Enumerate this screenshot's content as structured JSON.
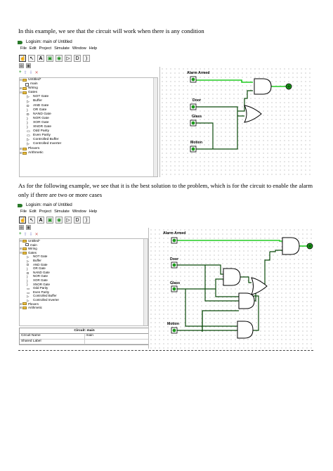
{
  "paragraph1": "In this example, we see that the circuit will work when there is any condition",
  "paragraph2": "As for the following example, we see that it is the best solution to the problem, which is for the circuit to enable the alarm only if there are two or more cases",
  "app": {
    "title": "Logisim: main of Untitled",
    "menu": [
      "File",
      "Edit",
      "Project",
      "Simulate",
      "Window",
      "Help"
    ],
    "tree": {
      "project": "Untitled*",
      "main": "main",
      "wiring": "Wiring",
      "gates": "Gates",
      "gate_items": [
        "NOT Gate",
        "Buffer",
        "AND Gate",
        "OR Gate",
        "NAND Gate",
        "NOR Gate",
        "XOR Gate",
        "XNOR Gate",
        "Odd Parity",
        "Even Parity",
        "Controlled Buffer",
        "Controlled Inverter"
      ],
      "plexers": "Plexers",
      "arithmetic": "Arithmetic"
    }
  },
  "circuit1": {
    "labels": {
      "alarm": "Alarm Armed",
      "door": "Door",
      "glass": "Glass",
      "motion": "Motion"
    }
  },
  "circuit2": {
    "labels": {
      "alarm": "Alarm Armed",
      "door": "Door",
      "glass": "Glass",
      "motion": "Motion"
    }
  },
  "properties": {
    "header": "Circuit: main",
    "rows": [
      {
        "name": "Circuit Name",
        "value": "main"
      },
      {
        "name": "Shared Label",
        "value": ""
      }
    ]
  },
  "colors": {
    "wire_on": "#22cc22",
    "wire_off": "#0a4a0a",
    "pin": "#1a9a1a"
  }
}
